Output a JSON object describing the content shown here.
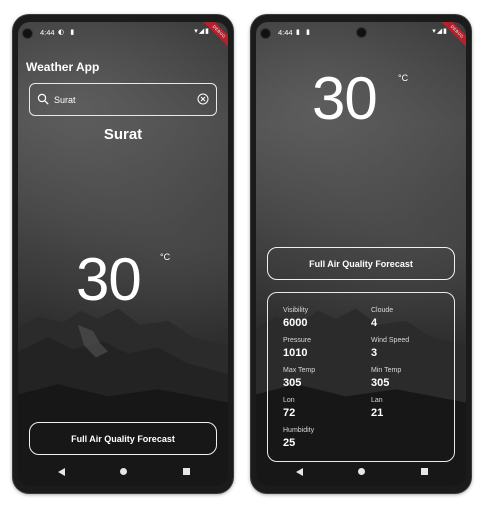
{
  "status": {
    "time": "4:44",
    "ribbon": "DEBUG"
  },
  "app": {
    "title": "Weather App"
  },
  "search": {
    "value": "Surat",
    "placeholder": ""
  },
  "city": "Surat",
  "weather": {
    "temperature": "30",
    "unit": "°C"
  },
  "forecast_button": {
    "label": "Full Air Quality Forecast"
  },
  "stats": [
    {
      "label": "Visibility",
      "value": "6000"
    },
    {
      "label": "Cloude",
      "value": "4"
    },
    {
      "label": "Pressure",
      "value": "1010"
    },
    {
      "label": "Wind Speed",
      "value": "3"
    },
    {
      "label": "Max Temp",
      "value": "305"
    },
    {
      "label": "Min Temp",
      "value": "305"
    },
    {
      "label": "Lon",
      "value": "72"
    },
    {
      "label": "Lan",
      "value": "21"
    },
    {
      "label": "Humbidity",
      "value": "25"
    }
  ],
  "icons": {
    "search": "search-icon",
    "clear": "clear-icon",
    "back": "back-icon",
    "home": "home-icon",
    "recents": "recents-icon"
  },
  "colors": {
    "text": "#ffffff",
    "ribbon": "#b0232e",
    "border": "#e9e9e9"
  }
}
